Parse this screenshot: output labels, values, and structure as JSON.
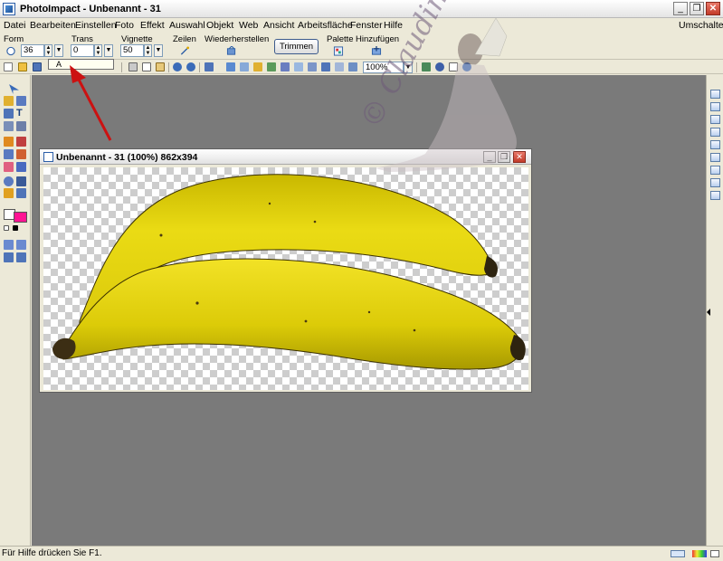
{
  "window": {
    "title": "PhotoImpact - Unbenannt - 31",
    "controls": [
      "_",
      "❐",
      "✕"
    ]
  },
  "menu": {
    "items": [
      "Datei",
      "Bearbeiten",
      "Einstellen",
      "Foto",
      "Effekt",
      "Auswahl",
      "Objekt",
      "Web",
      "Ansicht",
      "Arbeitsfläche",
      "Fenster",
      "Hilfe"
    ],
    "right_item": "Umschalten"
  },
  "attributes": {
    "form_label": "Form",
    "trans_label": "Trans",
    "trans_value": "0",
    "vignette_label": "Vignette",
    "vignette_value": "50",
    "form_value": "36",
    "zeilen_label": "Zeilen",
    "wiederherstellen_label": "Wiederherstellen",
    "trimmen_button": "Trimmen",
    "palette_label": "Palette",
    "hinzufuegen_label": "Hinzufügen"
  },
  "toolbar": {
    "zoom_value": "100%",
    "tooltip_glyph": "A"
  },
  "document": {
    "title": "Unbenannt - 31 (100%) 862x394"
  },
  "status": {
    "text": "Für Hilfe drücken Sie F1."
  },
  "watermark": {
    "text": "© Claudinia"
  },
  "colors": {
    "workspace_bg": "#7a7a7a",
    "chrome_bg": "#ece9d8",
    "background_swatch": "#ff1493",
    "foreground_swatch": "#ffffff",
    "arrow": "#cc1111",
    "banana": "#e6d40a"
  },
  "icons": {
    "form_shape": "circle-icon",
    "zeilen": "wand-icon",
    "wiederherstellen": "restore-icon",
    "palette": "palette-icon",
    "hinzufuegen": "add-icon"
  }
}
